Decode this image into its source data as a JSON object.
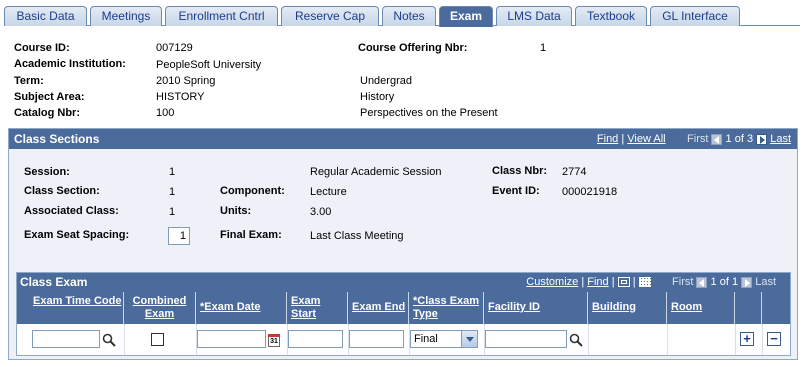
{
  "tabs": [
    {
      "label": "Basic Data"
    },
    {
      "label": "Meetings"
    },
    {
      "label": "Enrollment Cntrl"
    },
    {
      "label": "Reserve Cap"
    },
    {
      "label": "Notes"
    },
    {
      "label": "Exam"
    },
    {
      "label": "LMS Data"
    },
    {
      "label": "Textbook"
    },
    {
      "label": "GL Interface"
    }
  ],
  "header": {
    "course_id_label": "Course ID:",
    "course_id": "007129",
    "offering_label": "Course Offering Nbr:",
    "offering": "1",
    "institution_label": "Academic Institution:",
    "institution": "PeopleSoft University",
    "term_label": "Term:",
    "term": "2010 Spring",
    "career": "Undergrad",
    "subject_label": "Subject Area:",
    "subject": "HISTORY",
    "subject_desc": "History",
    "catalog_label": "Catalog Nbr:",
    "catalog": "100",
    "catalog_desc": "Perspectives on the Present"
  },
  "class_sections": {
    "title": "Class Sections",
    "find": "Find",
    "sep": "|",
    "view_all": "View All",
    "first": "First",
    "range": "1 of 3",
    "last": "Last",
    "session_label": "Session:",
    "session": "1",
    "session_desc": "Regular Academic Session",
    "class_nbr_label": "Class Nbr:",
    "class_nbr": "2774",
    "class_section_label": "Class Section:",
    "class_section": "1",
    "component_label": "Component:",
    "component": "Lecture",
    "event_id_label": "Event ID:",
    "event_id": "000021918",
    "assoc_label": "Associated Class:",
    "assoc": "1",
    "units_label": "Units:",
    "units": "3.00",
    "seat_spacing_label": "Exam Seat Spacing:",
    "seat_spacing": "1",
    "final_exam_label": "Final Exam:",
    "final_exam": "Last Class Meeting"
  },
  "class_exam": {
    "title": "Class Exam",
    "customize": "Customize",
    "sep": "|",
    "find": "Find",
    "first": "First",
    "range": "1 of 1",
    "last": "Last",
    "columns": [
      {
        "label": "Exam Time Code"
      },
      {
        "label": "Combined Exam"
      },
      {
        "label": "*Exam Date"
      },
      {
        "label": "Exam Start"
      },
      {
        "label": "Exam End"
      },
      {
        "label": "*Class Exam Type"
      },
      {
        "label": "Facility ID"
      },
      {
        "label": "Building"
      },
      {
        "label": "Room"
      }
    ],
    "row": {
      "exam_time_code": "",
      "exam_date": "",
      "exam_start": "",
      "exam_end": "",
      "exam_type": "Final",
      "facility_id": "",
      "calendar_text": "31",
      "add": "+",
      "remove": "−"
    }
  },
  "colors": {
    "header_blue": "#4a6b9b",
    "link_blue": "#1c3c8c",
    "panel_bg": "#eef2f8"
  }
}
